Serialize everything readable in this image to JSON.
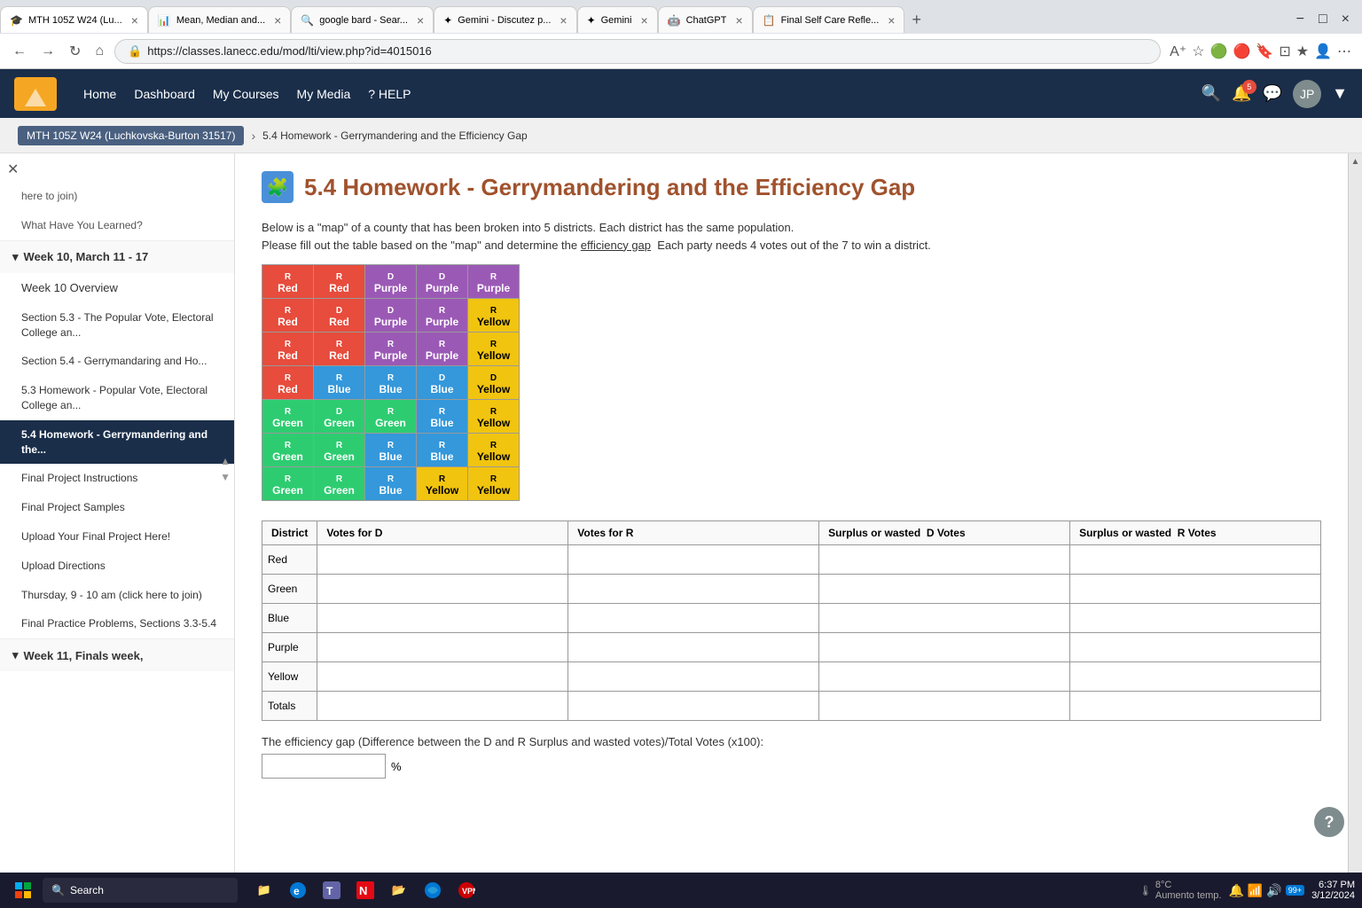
{
  "browser": {
    "tabs": [
      {
        "id": "t1",
        "title": "MTH 105Z W24 (Lu...",
        "active": true,
        "favicon": "🎓"
      },
      {
        "id": "t2",
        "title": "Mean, Median and...",
        "active": false,
        "favicon": "📊"
      },
      {
        "id": "t3",
        "title": "google bard - Sear...",
        "active": false,
        "favicon": "🔍"
      },
      {
        "id": "t4",
        "title": "Gemini - Discutez p...",
        "active": false,
        "favicon": "✦"
      },
      {
        "id": "t5",
        "title": "Gemini",
        "active": false,
        "favicon": "✦"
      },
      {
        "id": "t6",
        "title": "ChatGPT",
        "active": false,
        "favicon": "🤖"
      },
      {
        "id": "t7",
        "title": "Final Self Care Refle...",
        "active": false,
        "favicon": "📋"
      }
    ],
    "url": "https://classes.lanecc.edu/mod/lti/view.php?id=4015016"
  },
  "lms_nav": {
    "home": "Home",
    "dashboard": "Dashboard",
    "my_courses": "My Courses",
    "my_media": "My Media",
    "help": "? HELP",
    "notifications_count": "5"
  },
  "breadcrumb": {
    "course": "MTH 105Z W24 (Luchkovska-Burton 31517)",
    "current": "5.4 Homework - Gerrymandering and the Efficiency Gap"
  },
  "page": {
    "title": "5.4 Homework - Gerrymandering and the Efficiency Gap",
    "description_line1": "Below is a \"map\" of a county that has been broken into 5 districts. Each district has the same population.",
    "description_line2": "Please fill out the table based on the \"map\" and determine the efficiency gap  Each party needs 4 votes out of the 7 to win a district."
  },
  "map_grid": {
    "cells": [
      [
        "R Red",
        "R Red",
        "D Purple",
        "D Purple",
        "R Purple"
      ],
      [
        "R Red",
        "D Red",
        "D Purple",
        "R Purple",
        "R Yellow"
      ],
      [
        "R Red",
        "R Red",
        "R Purple",
        "R Purple",
        "R Yellow"
      ],
      [
        "R Red",
        "R Blue",
        "R Blue",
        "D Blue",
        "D Yellow"
      ],
      [
        "R Green",
        "D Green",
        "R Green",
        "R Blue",
        "R Yellow"
      ],
      [
        "R Green",
        "R Green",
        "R Blue",
        "R Blue",
        "R Yellow"
      ],
      [
        "R Green",
        "R Green",
        "R Blue",
        "R Yellow",
        "R Yellow"
      ]
    ],
    "cell_styles": [
      [
        "cell-r-red",
        "cell-r-red",
        "cell-d-purple",
        "cell-d-purple",
        "cell-r-purple"
      ],
      [
        "cell-r-red",
        "cell-d-red",
        "cell-d-purple",
        "cell-r-purple",
        "cell-r-yellow"
      ],
      [
        "cell-r-red",
        "cell-r-red",
        "cell-r-purple",
        "cell-r-purple",
        "cell-r-yellow"
      ],
      [
        "cell-r-red",
        "cell-r-blue",
        "cell-r-blue",
        "cell-d-blue",
        "cell-d-yellow"
      ],
      [
        "cell-r-green",
        "cell-d-green",
        "cell-r-green",
        "cell-r-blue",
        "cell-r-yellow"
      ],
      [
        "cell-r-green",
        "cell-r-green",
        "cell-r-blue",
        "cell-r-blue",
        "cell-r-yellow"
      ],
      [
        "cell-r-green",
        "cell-r-green",
        "cell-r-blue",
        "cell-r-yellow",
        "cell-r-yellow"
      ]
    ]
  },
  "data_table": {
    "headers": [
      "District",
      "Votes for D",
      "Votes for R",
      "Surplus or wasted  D Votes",
      "Surplus or wasted  R Votes"
    ],
    "rows": [
      {
        "district": "Red",
        "votes_d": "",
        "votes_r": "",
        "surplus_d": "",
        "surplus_r": ""
      },
      {
        "district": "Green",
        "votes_d": "",
        "votes_r": "",
        "surplus_d": "",
        "surplus_r": ""
      },
      {
        "district": "Blue",
        "votes_d": "",
        "votes_r": "",
        "surplus_d": "",
        "surplus_r": ""
      },
      {
        "district": "Purple",
        "votes_d": "",
        "votes_r": "",
        "surplus_d": "",
        "surplus_r": ""
      },
      {
        "district": "Yellow",
        "votes_d": "",
        "votes_r": "",
        "surplus_d": "",
        "surplus_r": ""
      },
      {
        "district": "Totals",
        "votes_d": "",
        "votes_r": "",
        "surplus_d": "",
        "surplus_r": ""
      }
    ]
  },
  "efficiency_gap": {
    "label": "The efficiency gap (Difference between the D and R Surplus and wasted votes)/Total Votes (x100):",
    "value": "",
    "unit": "%"
  },
  "sidebar": {
    "close_label": "×",
    "items": [
      {
        "label": "here to join)",
        "active": false,
        "indent": true
      },
      {
        "label": "What Have You Learned?",
        "active": false,
        "indent": true
      },
      {
        "label": "Week 10, March 11 - 17",
        "section": true,
        "expanded": true
      },
      {
        "label": "Week 10 Overview",
        "active": false,
        "indent": true
      },
      {
        "label": "Section 5.3 - The Popular Vote, Electoral College an...",
        "active": false,
        "indent": true
      },
      {
        "label": "Section 5.4 - Gerrymandaring and Ho...",
        "active": false,
        "indent": true
      },
      {
        "label": "5.3 Homework - Popular Vote, Electoral College an...",
        "active": false,
        "indent": true
      },
      {
        "label": "5.4 Homework - Gerrymandering and the...",
        "active": true,
        "indent": true
      },
      {
        "label": "Final Project Instructions",
        "active": false,
        "indent": true
      },
      {
        "label": "Final Project Samples",
        "active": false,
        "indent": true
      },
      {
        "label": "Upload Your Final Project Here!",
        "active": false,
        "indent": true
      },
      {
        "label": "Upload Directions",
        "active": false,
        "indent": true
      },
      {
        "label": "Thursday, 9 - 10 am (click here to join)",
        "active": false,
        "indent": true
      },
      {
        "label": "Final Practice Problems, Sections 3.3-5.4",
        "active": false,
        "indent": true
      },
      {
        "label": "Week 11, Finals week,",
        "section": true,
        "expanded": false
      }
    ]
  },
  "taskbar": {
    "search_placeholder": "Search",
    "time": "6:37 PM",
    "date": "3/12/2024",
    "weather": "8°C",
    "weather_label": "Aumento temp.",
    "notification_count": "99+"
  },
  "help_button_label": "?"
}
